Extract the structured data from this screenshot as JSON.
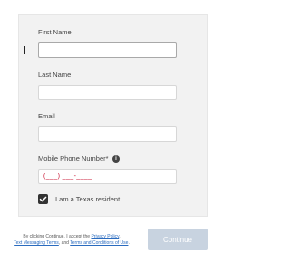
{
  "form": {
    "first_name": {
      "label": "First Name",
      "value": ""
    },
    "last_name": {
      "label": "Last Name",
      "value": ""
    },
    "email": {
      "label": "Email",
      "value": ""
    },
    "mobile_phone": {
      "label": "Mobile Phone Number*",
      "placeholder": "(___) ___-____",
      "value": ""
    },
    "texas_resident": {
      "label": "I am a Texas resident",
      "checked": true
    }
  },
  "consent": {
    "prefix": "By clicking Continue, I accept the",
    "privacy_policy": "Privacy Policy",
    "separator": ",",
    "text_messaging_terms": "Text Messaging Terms",
    "and": ", and",
    "terms_and_conditions": "Terms and Conditions of Use",
    "suffix": "."
  },
  "continue_button": {
    "label": "Continue",
    "disabled": true
  },
  "colors": {
    "panel_background": "#f2f2f2",
    "button_disabled": "#c8d3e0",
    "link": "#2a6bbf",
    "mask_placeholder": "#c8102e"
  },
  "icons": {
    "phone_info": "info-circle-icon",
    "checkbox": "checkmark-icon"
  }
}
